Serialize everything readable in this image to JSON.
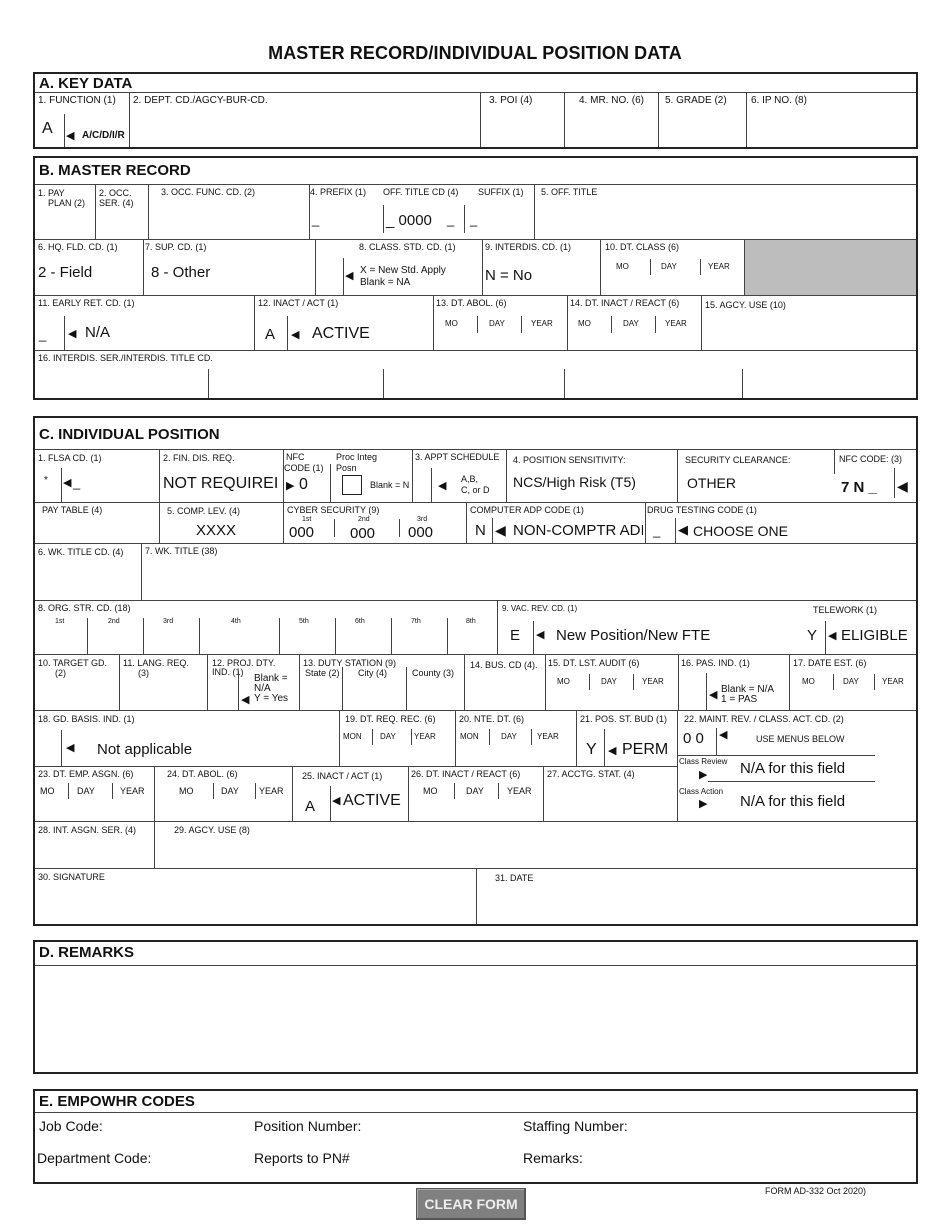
{
  "page": {
    "title": "MASTER RECORD/INDIVIDUAL POSITION DATA",
    "footer": "FORM AD-332  Oct 2020)",
    "clear_button": "CLEAR FORM"
  },
  "section_a": {
    "heading": "A.  KEY DATA",
    "function_label": "1.  FUNCTION (1)",
    "function_value": "A",
    "function_hint": "A/C/D/I/R",
    "dept_label": "2.  DEPT. CD./AGCY-BUR-CD.",
    "poi_label": "3. POI (4)",
    "mr_no_label": "4.  MR. NO. (6)",
    "grade_label": "5.  GRADE (2)",
    "ip_no_label": "6.  IP NO. (8)"
  },
  "section_b": {
    "heading": "B.  MASTER RECORD",
    "pay_plan_label_1": "1. PAY",
    "pay_plan_label_2": "PLAN (2)",
    "occ_ser_label_1": "2. OCC.",
    "occ_ser_label_2": "SER. (4)",
    "occ_func_label": "3. OCC. FUNC. CD. (2)",
    "prefix_label": "4. PREFIX (1)",
    "prefix_value": "_",
    "off_title_cd_label": "OFF. TITLE CD (4)",
    "off_title_cd_value": "_ 0000",
    "off_title_cd_trail": "_",
    "suffix_label": "SUFFIX (1)",
    "suffix_value": "_",
    "off_title_label": "5.  OFF. TITLE",
    "hq_fld_label": "6. HQ. FLD. CD. (1)",
    "hq_fld_value": "2 - Field",
    "sup_cd_label": "7. SUP. CD. (1)",
    "sup_cd_value": "8 - Other",
    "class_std_label": "8. CLASS. STD. CD. (1)",
    "class_std_hint_1": "X = New Std. Apply",
    "class_std_hint_2": "Blank = NA",
    "interdis_cd_label": "9. INTERDIS. CD. (1)",
    "interdis_cd_value": "N = No",
    "dt_class_label": "10. DT. CLASS  (6)",
    "early_ret_label": "11. EARLY RET. CD. (1)",
    "early_ret_code": "_",
    "early_ret_value": "N/A",
    "inact_act_label": "12. INACT / ACT (1)",
    "inact_act_code": "A",
    "inact_act_value": "ACTIVE",
    "dt_abol_label": "13. DT. ABOL. (6)",
    "dt_inact_label": "14. DT. INACT / REACT (6)",
    "agcy_use_label": "15. AGCY. USE (10)",
    "interdis_ser_label": "16. INTERDIS. SER./INTERDIS. TITLE CD."
  },
  "date_parts": {
    "mo": "MO",
    "mon": "MON",
    "day": "DAY",
    "year": "YEAR"
  },
  "section_c": {
    "heading": "C.  INDIVIDUAL POSITION",
    "flsa_label": "1.  FLSA CD. (1)",
    "flsa_marker": "*",
    "flsa_value": "_",
    "fin_dis_label": "2. FIN. DIS. REQ.",
    "fin_dis_value": "NOT REQUIREI",
    "nfc_code_label_1": "NFC",
    "nfc_code_label_2": "CODE (1)",
    "nfc_code_value": "0",
    "proc_integ_label_1": "Proc Integ",
    "proc_integ_label_2": "Posn",
    "proc_integ_hint": "Blank = N",
    "appt_schedule_label": "3. APPT SCHEDULE",
    "appt_schedule_hint_1": "A,B,",
    "appt_schedule_hint_2": "C, or D",
    "pos_sens_label": "4. POSITION SENSITIVITY:",
    "pos_sens_value": "NCS/High Risk (T5)",
    "sec_clear_label": "SECURITY CLEARANCE:",
    "sec_clear_value": "OTHER",
    "nfc_code3_label": "NFC CODE: (3)",
    "nfc_code3_value": "7 N _",
    "pay_table_label": "PAY TABLE (4)",
    "comp_lev_label": "5.   COMP. LEV. (4)",
    "comp_lev_value": "XXXX",
    "cyber_label": "CYBER SECURITY (9)",
    "cyber": [
      {
        "ord": "1st",
        "value": "000"
      },
      {
        "ord": "2nd",
        "value": "000"
      },
      {
        "ord": "3rd",
        "value": "000"
      }
    ],
    "adp_label": "COMPUTER ADP CODE (1)",
    "adp_code": "N",
    "adp_value": "NON-COMPTR ADI",
    "drug_label": "DRUG TESTING CODE (1)",
    "drug_code": "_",
    "drug_value": "CHOOSE ONE",
    "wk_title_cd_label": "6. WK. TITLE CD. (4)",
    "wk_title_label": "7. WK. TITLE (38)",
    "org_str_label": "8. ORG. STR. CD. (18)",
    "org_levels": [
      "1st",
      "2nd",
      "3rd",
      "4th",
      "5th",
      "6th",
      "7th",
      "8th"
    ],
    "vac_rev_label": "9. VAC. REV. CD. (1)",
    "vac_rev_code": "E",
    "vac_rev_value": "New Position/New FTE",
    "telework_label": "TELEWORK (1)",
    "telework_code": "Y",
    "telework_value": "ELIGIBLE",
    "target_gd_label_1": "10. TARGET GD.",
    "target_gd_label_2": "(2)",
    "lang_req_label_1": "11. LANG. REQ.",
    "lang_req_label_2": "(3)",
    "proj_dty_label_1": "12. PROJ. DTY.",
    "proj_dty_label_2": "IND. (1)",
    "proj_dty_hint_1": "Blank =",
    "proj_dty_hint_2": "N/A",
    "proj_dty_hint_3": "Y = Yes",
    "duty_station_label": "13. DUTY STATION (9)",
    "duty_state_label": "State (2)",
    "duty_city_label": "City (4)",
    "duty_county_label": "County (3)",
    "bus_cd_label": "14. BUS. CD (4).",
    "dt_lst_audit_label": "15. DT. LST. AUDIT (6)",
    "pas_ind_label": "16. PAS. IND. (1)",
    "pas_ind_hint_1": "Blank = N/A",
    "pas_ind_hint_2": "1 = PAS",
    "date_est_label": "17. DATE EST. (6)",
    "gd_basis_label": "18. GD. BASIS. IND. (1)",
    "gd_basis_value": "Not applicable",
    "dt_req_rec_label": "19. DT. REQ. REC. (6)",
    "nte_dt_label": "20. NTE. DT. (6)",
    "pos_st_bud_label": "21. POS. ST. BUD (1)",
    "pos_st_bud_code": "Y",
    "pos_st_bud_value": "PERM",
    "maint_rev_label": "22. MAINT. REV. / CLASS. ACT. CD. (2)",
    "maint_rev_value": "0 0",
    "maint_rev_hint": "USE MENUS BELOW",
    "class_review_label": "Class Review",
    "class_review_value": "N/A for this field",
    "class_action_label": "Class Action",
    "class_action_value": "N/A for this field",
    "dt_emp_asgn_label": "23. DT. EMP. ASGN. (6)",
    "dt_abol_label": "24. DT. ABOL. (6)",
    "inact_act_label": "25. INACT / ACT (1)",
    "inact_act_code": "A",
    "inact_act_value": "ACTIVE",
    "dt_inact_label": "26. DT. INACT / REACT (6)",
    "acctg_stat_label": "27. ACCTG. STAT. (4)",
    "int_asgn_label": "28. INT. ASGN. SER. (4)",
    "agcy_use_label": "29. AGCY. USE (8)",
    "signature_label": "30. SIGNATURE",
    "date_label": "31. DATE"
  },
  "section_d": {
    "heading": "D.  REMARKS"
  },
  "section_e": {
    "heading": "E.  EMPOWHR CODES",
    "job_code_label": "Job Code:",
    "position_number_label": "Position Number:",
    "staffing_number_label": "Staffing Number:",
    "department_code_label": "Department Code:",
    "reports_to_label": "Reports to PN#",
    "remarks_label": "Remarks:"
  },
  "icons": {
    "left_arrow": "◀",
    "right_arrow": "▶"
  }
}
